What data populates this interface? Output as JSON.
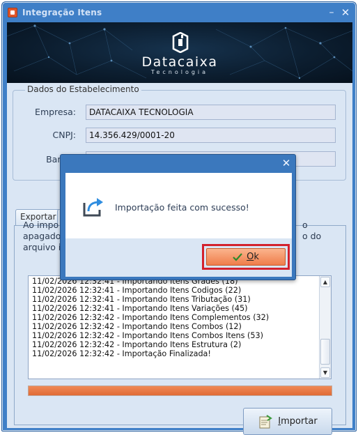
{
  "window": {
    "title": "Integração Itens",
    "minimize_glyph": "–",
    "close_glyph": "✕"
  },
  "banner": {
    "brand": "Datacaixa",
    "tagline": "Tecnologia"
  },
  "establishment": {
    "legend": "Dados do Estabelecimento",
    "empresa_label": "Empresa:",
    "empresa_value": "DATACAIXA TECNOLOGIA",
    "cnpj_label": "CNPJ:",
    "cnpj_value": "14.356.429/0001-20",
    "banco_label": "Banco:",
    "banco_value": ""
  },
  "tabs": {
    "exportar": "Exportar"
  },
  "info": {
    "line1_left": "Ao impo",
    "line1_right": "o",
    "line2_left": "apagado",
    "line2_right": "o do",
    "line3_left": "arquivo i"
  },
  "log_lines": [
    "11/02/2026 12:32:41 - Importando Itens Grades (18)",
    "11/02/2026 12:32:41 - Importando Itens Codigos (22)",
    "11/02/2026 12:32:41 - Importando Itens Tributação (31)",
    "11/02/2026 12:32:41 - Importando Itens Variações (45)",
    "11/02/2026 12:32:42 - Importando Itens Complementos (32)",
    "11/02/2026 12:32:42 - Importando Itens Combos (12)",
    "11/02/2026 12:32:42 - Importando Itens Combos Itens (53)",
    "11/02/2026 12:32:42 - Importando Itens Estrutura (2)",
    "11/02/2026 12:32:42 - Importação Finalizada!"
  ],
  "progress": {
    "percent": 100
  },
  "buttons": {
    "importar": "Importar",
    "importar_mnemonic": "I",
    "importar_rest": "mportar"
  },
  "modal": {
    "close_glyph": "✕",
    "message": "Importação feita com sucesso!",
    "ok_label": "Ok",
    "ok_mnemonic": "O",
    "ok_rest": "k"
  },
  "colors": {
    "accent_orange": "#e9733d",
    "highlight_red": "#d3212d",
    "window_blue": "#3f7fc7"
  }
}
